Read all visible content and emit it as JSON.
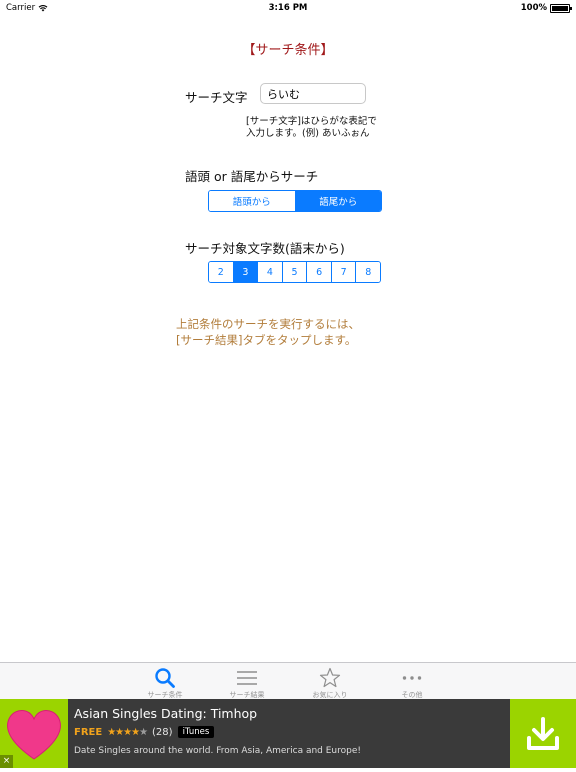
{
  "status": {
    "carrier": "Carrier",
    "time": "3:16 PM",
    "battery": "100%"
  },
  "screen": {
    "title": "【サーチ条件】",
    "search_label": "サーチ文字",
    "search_value": "らいむ",
    "hint_line1": "[サーチ文字]はひらがな表記で",
    "hint_line2": "入力します。(例) あいふぉん",
    "position_label": "語頭 or 語尾からサーチ",
    "position_options": [
      "語頭から",
      "語尾から"
    ],
    "position_selected": 1,
    "count_label": "サーチ対象文字数(語末から)",
    "count_options": [
      "2",
      "3",
      "4",
      "5",
      "6",
      "7",
      "8"
    ],
    "count_selected": 1,
    "note_line1": "上記条件のサーチを実行するには、",
    "note_line2": "[サーチ結果]タブをタップします。"
  },
  "tabs": [
    {
      "label": "サーチ条件",
      "icon": "search-icon",
      "active": true
    },
    {
      "label": "サーチ結果",
      "icon": "list-icon",
      "active": false
    },
    {
      "label": "お気に入り",
      "icon": "star-icon",
      "active": false
    },
    {
      "label": "その他",
      "icon": "more-icon",
      "active": false
    }
  ],
  "ad": {
    "title": "Asian Singles Dating: Timhop",
    "price": "FREE",
    "rating_count": "(28)",
    "store": "iTunes",
    "description": "Date Singles around the world. From Asia, America and Europe!",
    "close": "×"
  },
  "colors": {
    "accent": "#0a7bff",
    "title": "#a0181a",
    "note": "#b27d3b",
    "ad_green": "#9bd400"
  }
}
